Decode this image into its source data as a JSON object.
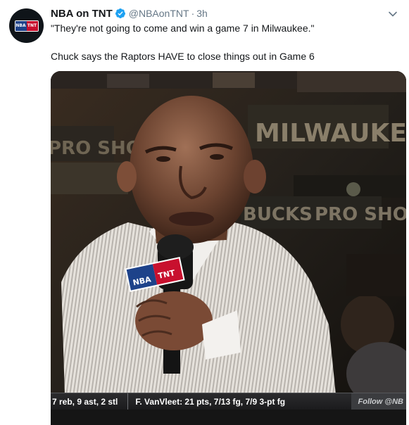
{
  "tweet": {
    "display_name": "NBA on TNT",
    "handle": "@NBAonTNT",
    "separator": "·",
    "time": "3h",
    "text_line1": "\"They're not going to come and win a game 7 in Milwaukee.\"",
    "text_line2": "Chuck says the Raptors HAVE to close things out in Game 6"
  },
  "avatar": {
    "logo_left": "NBA",
    "logo_right": "TNT"
  },
  "media": {
    "sign_top": "MILWAUKEE",
    "sign_left": "PRO SHOP",
    "sign_bucks": "BUCKS",
    "sign_pro": "PRO SHOP",
    "mic_flag_left": "NBA",
    "mic_flag_right": "TNT",
    "ticker_left": "7 reb, 9 ast, 2 stl",
    "ticker_right": "F. VanVleet:  21 pts, 7/13 fg, 7/9 3-pt fg",
    "ticker_follow": "Follow @NB"
  },
  "colors": {
    "verified": "#1da1f2",
    "muted_text": "#657786",
    "nba_blue": "#1d428a",
    "nba_red": "#c8102e"
  }
}
